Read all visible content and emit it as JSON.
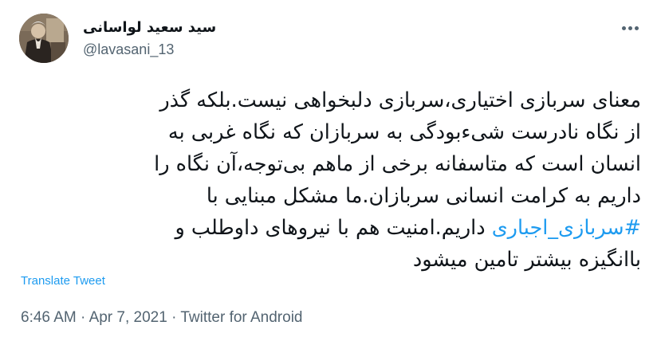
{
  "author": {
    "name": "سید سعید لواسانی",
    "handle": "@lavasani_13"
  },
  "tweet": {
    "line1": "معنای سربازی اختیاری،سربازی دلبخواهی نیست.بلکه گذر",
    "line2": "از نگاه نادرست شیءبودگی به سربازان که نگاه غربی به",
    "line3": "انسان است که متاسفانه برخی از ماهم بی‌توجه،آن نگاه را",
    "line4": "داریم به کرامت انسانی سربازان.ما مشکل مبنایی با",
    "hashtag": "#سربازی_اجباری",
    "line5_rest": "داریم.امنیت هم با نیروهای داوطلب و",
    "line6": "باانگیزه بیشتر تامین میشود"
  },
  "translate_label": "Translate Tweet",
  "meta": {
    "time": "6:46 AM",
    "separator": "·",
    "date": "Apr 7, 2021",
    "source": "Twitter for Android"
  },
  "colors": {
    "link": "#1d9bf0",
    "secondary": "#536471",
    "text": "#0f1419"
  },
  "icons": {
    "more": "more-horizontal-icon",
    "avatar": "profile-photo"
  }
}
